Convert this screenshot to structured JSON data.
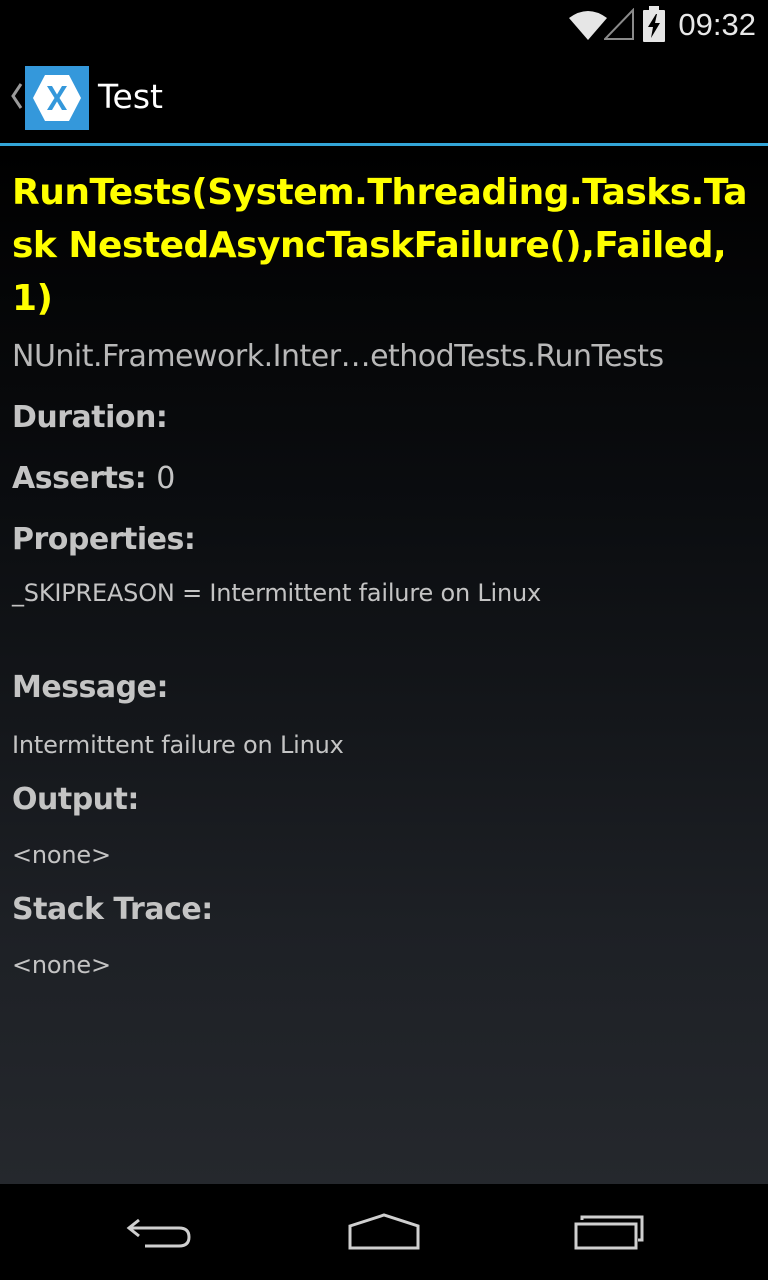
{
  "status_bar": {
    "time": "09:32",
    "icons": [
      "wifi-icon",
      "cell-signal-icon",
      "battery-charging-icon"
    ]
  },
  "action_bar": {
    "title": "Test",
    "app_icon": "xamarin-logo-icon",
    "back_icon": "up-caret-icon"
  },
  "detail": {
    "test_name": "RunTests(System.Threading.Tasks.Task NestedAsyncTaskFailure(),Failed,1)",
    "full_name": "NUnit.Framework.Inter…ethodTests.RunTests",
    "duration_label": "Duration:",
    "duration_value": "",
    "asserts_label": "Asserts:",
    "asserts_value": "0",
    "properties_label": "Properties:",
    "properties_value": "_SKIPREASON = Intermittent failure on Linux",
    "message_label": "Message:",
    "message_value": "Intermittent failure on Linux",
    "output_label": "Output:",
    "output_value": "<none>",
    "stack_label": "Stack Trace:",
    "stack_value": "<none>"
  },
  "nav_bar": {
    "icons": [
      "back-icon",
      "home-icon",
      "recents-icon"
    ]
  },
  "colors": {
    "accent": "#33a5d8",
    "test_name": "#ffff00",
    "app_icon_bg": "#3498db"
  }
}
